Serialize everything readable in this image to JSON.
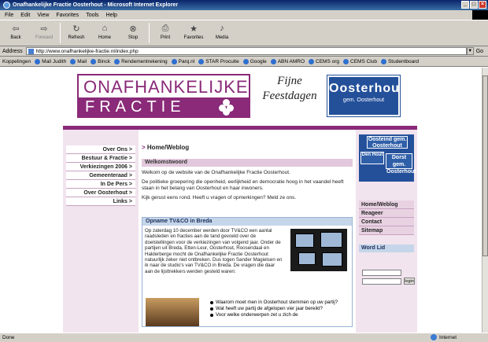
{
  "window": {
    "title": "Onafhankelijke Fractie Oosterhout - Microsoft Internet Explorer"
  },
  "menubar": {
    "items": [
      "File",
      "Edit",
      "View",
      "Favorites",
      "Tools",
      "Help"
    ]
  },
  "toolbar": {
    "buttons": [
      {
        "label": "Back",
        "icon": "back-arrow-icon"
      },
      {
        "label": "Forward",
        "icon": "forward-arrow-icon"
      },
      {
        "label": "Refresh",
        "icon": "refresh-icon"
      },
      {
        "label": "Home",
        "icon": "home-icon"
      },
      {
        "label": "Stop",
        "icon": "stop-icon"
      },
      {
        "label": "Print",
        "icon": "print-icon"
      },
      {
        "label": "Favorites",
        "icon": "favorites-icon"
      },
      {
        "label": "Media",
        "icon": "media-icon"
      }
    ]
  },
  "address": {
    "label": "Address",
    "url": "http://www.onafhankelijke-fractie.nl/index.php",
    "go": "Go"
  },
  "links": {
    "label": "Koppelingen",
    "items": [
      "Mail Judith",
      "Mail",
      "Binck",
      "Rendementrekening",
      "Parq.nl",
      "STAR Procuite",
      "Google",
      "ABN AMRO",
      "CEMS org",
      "CEMS Club",
      "Studentboard"
    ]
  },
  "site": {
    "logo_line1": "ONAFHANKELIJKE",
    "logo_line2": "FRACTIE",
    "greeting": "Fijne Feestdagen",
    "sign_big": "Oosterhout",
    "sign_small": "gem. Oosterhout",
    "left_nav": [
      "Over Ons >",
      "Bestuur & Fractie >",
      "Verkiezingen 2006 >",
      "Gemeenteraad >",
      "In De Pers >",
      "Over Oosterhout >",
      "Links >"
    ],
    "breadcrumb": "Home/Weblog",
    "welcome_heading": "Welkomstwoord",
    "welcome_p1": "Welkom op de website van de Onafhankelijke Fractie Oosterhout.",
    "welcome_p2": "De politieke groepering die openheid, eerlijkheid en democratie hoog in het vaandel heeft staan in het belang van Oosterhout en haar inwoners.",
    "welcome_p3": "Kijk gerust eens rond. Heeft u vragen of opmerkingen? Meld ze ons.",
    "news_heading": "Opname TV&CO in Breda",
    "news_text": "Op zaterdag 10 december werden door TV&CO een aantal raadsleden en fracties aan de tand gevoeld over de doelstellingen voor de verkiezingen van volgend jaar. Onder de partijen uit Breda, Etten-Leur, Oosterhout, Roosendaal en Halderberge mocht de Onafhankelijke Fractie Oosterhout natuurlijk zeker niet ontbreken. Dus togen Sander Magielsen en ik naar de studio's van TV&CO in Breda. De vragen die daar aan de lijsttrekkers werden gesteld waren:",
    "news_list": [
      "Waarom moet men in Oosterhout stemmen op uw partij?",
      "Wat heeft uw partij de afgelopen vier jaar bereikt?",
      "Voor welke onderwerpen zet u zich de"
    ],
    "sign2_top": "Oosteind gem. Oosterhout",
    "sign2_left": "Den Hout",
    "sign2_right": "Dorst gem. Oosterhout",
    "right_nav": [
      "Home/Weblog",
      "Reageer",
      "Contact",
      "Sitemap"
    ],
    "word_lid": "Word Lid",
    "login_button": "login"
  },
  "status": {
    "text": "Done",
    "zone": "Internet"
  },
  "colors": {
    "brand_purple": "#8a2a78",
    "sign_blue": "#24509a",
    "nav_bg": "#f1e4ee"
  }
}
